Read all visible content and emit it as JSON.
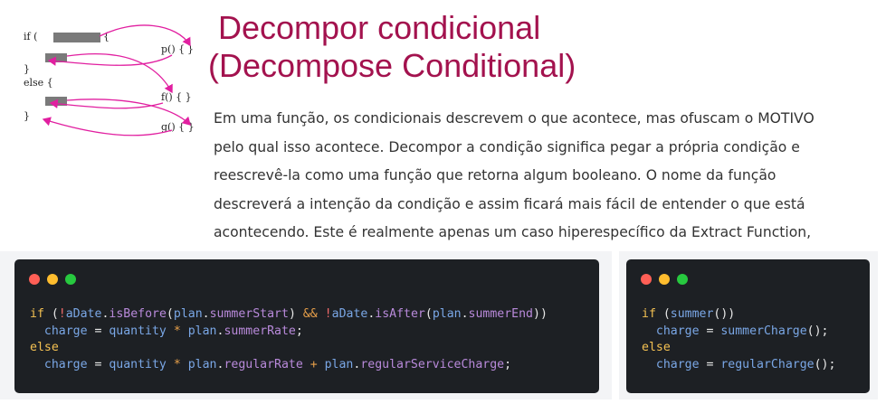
{
  "colors": {
    "title": "#a3124e",
    "arrow": "#e11fa0",
    "dot_red": "#ff5f56",
    "dot_yellow": "#ffbd2e",
    "dot_green": "#27c93f",
    "code_bg": "#1d2024"
  },
  "diagram": {
    "if_label": "if (",
    "brace_open": "{",
    "brace_close": "}",
    "else_label": "else {",
    "close_brace_2": "}",
    "p_label": "p() {",
    "p_close": "}",
    "f_label": "f() { }",
    "g_label": "g() { }"
  },
  "title": {
    "line1": "Decompor condicional",
    "line2": "(Decompose Conditional)"
  },
  "description": "Em uma função, os condicionais descrevem o que acontece, mas ofuscam o MOTIVO pelo qual isso acontece. Decompor a condição significa pegar a própria condição e reescrevê-la como uma função que retorna algum booleano. O nome da função descreverá a intenção da condição e assim ficará mais fácil de entender o que está acontecendo. Este é realmente apenas um caso hiperespecífico da Extract Function, específico para lógica condicional.",
  "code_left": {
    "l1": {
      "kw": "if",
      "p1": " (",
      "not1": "!",
      "aDate1": "aDate",
      "dot1": ".",
      "isBefore": "isBefore",
      "p2": "(",
      "plan1": "plan",
      "dot2": ".",
      "summerStart": "summerStart",
      "p3": ") ",
      "and": "&&",
      "sp": " ",
      "not2": "!",
      "aDate2": "aDate",
      "dot3": ".",
      "isAfter": "isAfter",
      "p4": "(",
      "plan2": "plan",
      "dot4": ".",
      "summerEnd": "summerEnd",
      "p5": "))"
    },
    "l2": {
      "indent": "  ",
      "charge": "charge",
      "eq": " = ",
      "quantity": "quantity",
      "mul": " * ",
      "plan": "plan",
      "dot": ".",
      "summerRate": "summerRate",
      "semi": ";"
    },
    "l3": {
      "kw": "else"
    },
    "l4": {
      "indent": "  ",
      "charge": "charge",
      "eq": " = ",
      "quantity": "quantity",
      "mul": " * ",
      "plan1": "plan",
      "dot1": ".",
      "regularRate": "regularRate",
      "plus": " + ",
      "plan2": "plan",
      "dot2": ".",
      "regularServiceCharge": "regularServiceCharge",
      "semi": ";"
    }
  },
  "code_right": {
    "l1": {
      "kw": "if",
      "p1": " (",
      "summer": "summer",
      "p2": "())"
    },
    "l2": {
      "indent": "  ",
      "charge": "charge",
      "eq": " = ",
      "fn": "summerCharge",
      "p": "();"
    },
    "l3": {
      "kw": "else"
    },
    "l4": {
      "indent": "  ",
      "charge": "charge",
      "eq": " = ",
      "fn": "regularCharge",
      "p": "();"
    }
  }
}
